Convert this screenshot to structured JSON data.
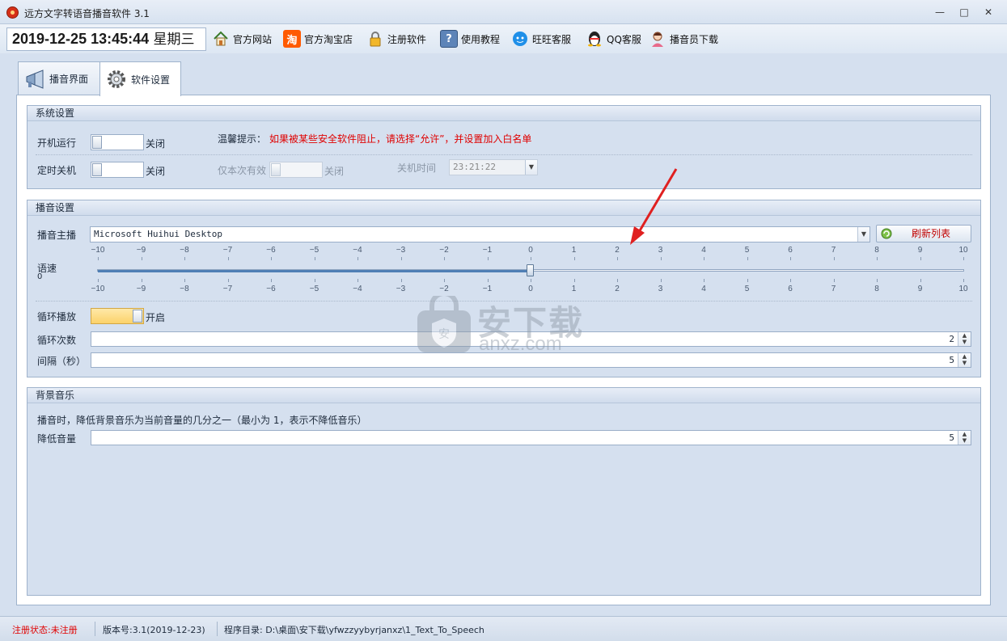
{
  "window": {
    "title": "远方文字转语音播音软件 3.1",
    "minimize_glyph": "—",
    "maximize_glyph": "□",
    "close_glyph": "✕"
  },
  "toolbar": {
    "date_time": "2019-12-25 13:45:44",
    "weekday": "星期三",
    "items": [
      {
        "label": "官方网站",
        "icon": "home-icon"
      },
      {
        "label": "官方淘宝店",
        "icon": "taobao-icon",
        "icon_text": "淘"
      },
      {
        "label": "注册软件",
        "icon": "lock-icon"
      },
      {
        "label": "使用教程",
        "icon": "help-book-icon",
        "icon_text": "?"
      },
      {
        "label": "旺旺客服",
        "icon": "wangwang-icon"
      },
      {
        "label": "QQ客服",
        "icon": "qq-penguin-icon"
      },
      {
        "label": "播音员下载",
        "icon": "announcer-icon"
      }
    ]
  },
  "tabs": [
    {
      "label": "播音界面",
      "icon": "megaphone-icon",
      "active": false
    },
    {
      "label": "软件设置",
      "icon": "gear-icon",
      "active": true
    }
  ],
  "system_settings": {
    "header": "系统设置",
    "autostart_label": "开机运行",
    "autostart_state": "关闭",
    "tip_label": "温馨提示：",
    "tip_text": "如果被某些安全软件阻止，请选择“允许”，并设置加入白名单",
    "shutdown_label": "定时关机",
    "shutdown_state": "关闭",
    "once_label": "仅本次有效",
    "once_state": "关闭",
    "shutdown_time_label": "关机时间",
    "shutdown_time_value": "23:21:22"
  },
  "broadcast_settings": {
    "header": "播音设置",
    "voice_label": "播音主播",
    "voice_value": "Microsoft Huihui Desktop",
    "refresh_button": "刷新列表",
    "speed_label": "语速",
    "speed_value": "0",
    "speed_ticks": [
      "−10",
      "−9",
      "−8",
      "−7",
      "−6",
      "−5",
      "−4",
      "−3",
      "−2",
      "−1",
      "0",
      "1",
      "2",
      "3",
      "4",
      "5",
      "6",
      "7",
      "8",
      "9",
      "10"
    ],
    "speed_min": -10,
    "speed_max": 10,
    "speed_current": 0,
    "loop_label": "循环播放",
    "loop_state": "开启",
    "loop_count_label": "循环次数",
    "loop_count_value": "2",
    "interval_label": "间隔（秒）",
    "interval_value": "5"
  },
  "bg_music": {
    "header": "背景音乐",
    "desc": "播音时，降低背景音乐为当前音量的几分之一（最小为 1，表示不降低音乐）",
    "reduce_label": "降低音量",
    "reduce_value": "5"
  },
  "watermark": {
    "text_cn": "安下载",
    "text_en": "anxz.com"
  },
  "statusbar": {
    "reg_status": "注册状态:未注册",
    "version": "版本号:3.1(2019-12-23)",
    "program_dir": "程序目录: D:\\桌面\\安下载\\yfwzzyybyrjanxz\\1_Text_To_Speech"
  },
  "colors": {
    "tip_red": "#e00000",
    "status_red": "#e00000",
    "annotation_arrow": "#e02020",
    "toggle_on": "#fbd26a"
  }
}
